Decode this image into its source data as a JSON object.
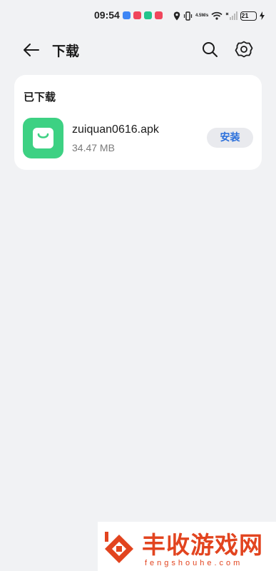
{
  "status_bar": {
    "time": "09:54",
    "net_speed_value": "4.5",
    "net_speed_unit": "M/s",
    "battery": "21"
  },
  "header": {
    "title": "下载",
    "back_icon": "arrow-left-icon",
    "search_icon": "search-icon",
    "settings_icon": "gear-icon"
  },
  "downloaded": {
    "section_title": "已下载",
    "items": [
      {
        "name": "zuiquan0616.apk",
        "size": "34.47 MB",
        "action_label": "安装",
        "icon": "shopping-bag-icon",
        "icon_color": "#3dd183"
      }
    ]
  },
  "watermark": {
    "text": "丰收游戏网",
    "subtext": "fengshouhe.com"
  },
  "colors": {
    "background": "#f1f2f4",
    "accent": "#2a6fdb",
    "app_icon": "#3dd183",
    "watermark": "#e2441f"
  }
}
